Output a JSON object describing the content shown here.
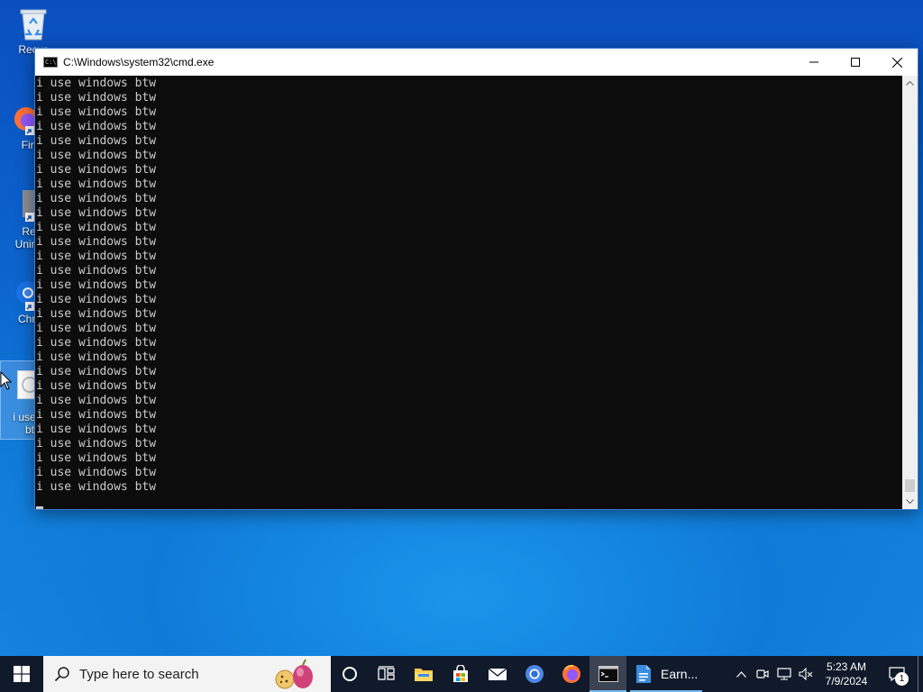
{
  "desktop": {
    "icons": [
      {
        "label": "Recyc"
      },
      {
        "label": "Fire"
      },
      {
        "label": "Re\nUnins"
      },
      {
        "label": "Chro"
      },
      {
        "label": "i use w\nbt"
      }
    ]
  },
  "window": {
    "title": "C:\\Windows\\system32\\cmd.exe",
    "minimize": "—",
    "maximize": "☐",
    "close": "✕"
  },
  "console": {
    "lines": [
      "i use windows btw",
      "i use windows btw",
      "i use windows btw",
      "i use windows btw",
      "i use windows btw",
      "i use windows btw",
      "i use windows btw",
      "i use windows btw",
      "i use windows btw",
      "i use windows btw",
      "i use windows btw",
      "i use windows btw",
      "i use windows btw",
      "i use windows btw",
      "i use windows btw",
      "i use windows btw",
      "i use windows btw",
      "i use windows btw",
      "i use windows btw",
      "i use windows btw",
      "i use windows btw",
      "i use windows btw",
      "i use windows btw",
      "i use windows btw",
      "i use windows btw",
      "i use windows btw",
      "i use windows btw",
      "i use windows btw",
      "i use windows btw"
    ]
  },
  "taskbar": {
    "search_placeholder": "Type here to search",
    "apps": [
      "cortana-circle",
      "task-view",
      "file-explorer",
      "microsoft-store",
      "mail",
      "chrome",
      "firefox",
      "cmd",
      "wordpad"
    ],
    "wordpad_label": "Earn...",
    "clock_time": "5:23 AM",
    "clock_date": "7/9/2024",
    "notification_count": "1"
  },
  "colors": {
    "console_bg": "#0c0c0c",
    "console_fg": "#cccccc",
    "taskbar_bg": "#101a2a",
    "desktop_blue": "#0b63cc"
  }
}
